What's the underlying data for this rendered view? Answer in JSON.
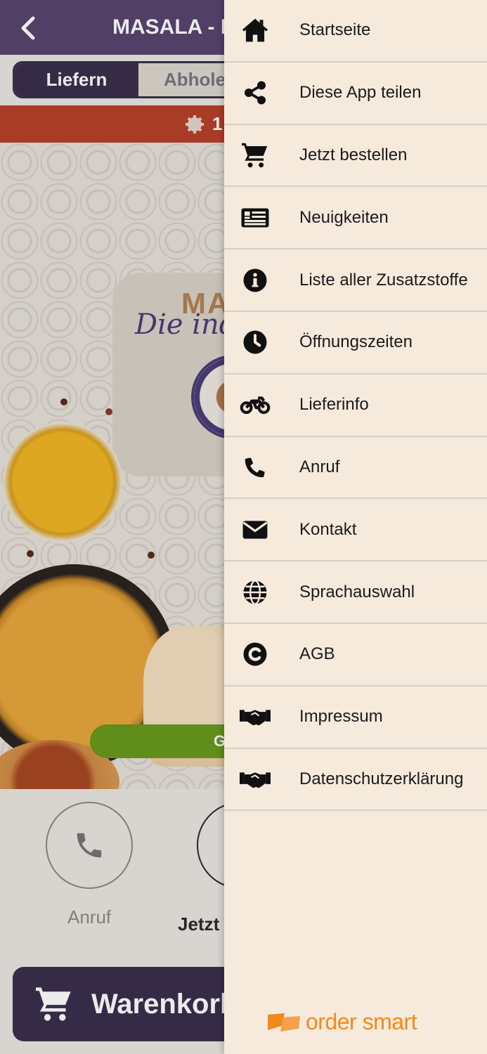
{
  "app": {
    "title": "MASALA - Di",
    "tabs": {
      "deliver": "Liefern",
      "pickup": "Abholen"
    },
    "promo_text": "1",
    "logo": {
      "text": "MA",
      "subtitle": "Die ind"
    },
    "green_button_label": "G",
    "call_label": "Anruf",
    "order_label": "Jetzt",
    "cart_label": "Warenkorb"
  },
  "drawer": {
    "items": [
      {
        "label": "Startseite",
        "icon": "home-icon"
      },
      {
        "label": "Diese App teilen",
        "icon": "share-icon"
      },
      {
        "label": "Jetzt bestellen",
        "icon": "cart-icon"
      },
      {
        "label": "Neuigkeiten",
        "icon": "news-icon"
      },
      {
        "label": "Liste aller Zusatzstoffe",
        "icon": "info-icon"
      },
      {
        "label": "Öffnungszeiten",
        "icon": "clock-icon"
      },
      {
        "label": "Lieferinfo",
        "icon": "motorcycle-icon"
      },
      {
        "label": "Anruf",
        "icon": "phone-icon"
      },
      {
        "label": "Kontakt",
        "icon": "envelope-icon"
      },
      {
        "label": "Sprachauswahl",
        "icon": "globe-icon"
      },
      {
        "label": "AGB",
        "icon": "copyright-icon"
      },
      {
        "label": "Impressum",
        "icon": "handshake-icon"
      },
      {
        "label": "Datenschutzerklärung",
        "icon": "handshake-icon"
      }
    ],
    "brand": "order smart"
  },
  "colors": {
    "topbar": "#58456e",
    "accent_dark": "#3b2f4d",
    "promo": "#b8422a",
    "drawer_bg": "#f5eadc",
    "brand_orange": "#f08a1d"
  }
}
